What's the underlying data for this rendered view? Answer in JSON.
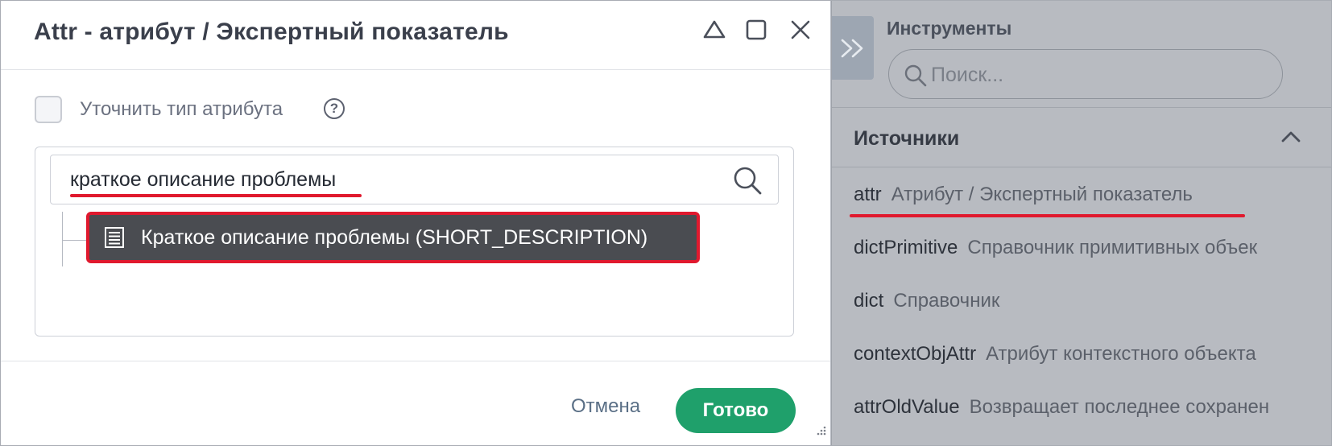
{
  "dialog": {
    "title": "Attr - атрибут / Экспертный показатель",
    "checkbox_label": "Уточнить тип атрибута",
    "help_symbol": "?",
    "search_value": "краткое описание проблемы",
    "tree_item_label": "Краткое описание проблемы (SHORT_DESCRIPTION)",
    "cancel_label": "Отмена",
    "ok_label": "Готово"
  },
  "tools": {
    "title": "Инструменты",
    "search_placeholder": "Поиск...",
    "sources_title": "Источники",
    "items": [
      {
        "key": "attr",
        "desc": "Атрибут / Экспертный показатель"
      },
      {
        "key": "dictPrimitive",
        "desc": "Справочник примитивных объек"
      },
      {
        "key": "dict",
        "desc": "Справочник"
      },
      {
        "key": "contextObjAttr",
        "desc": "Атрибут контекстного объекта"
      },
      {
        "key": "attrOldValue",
        "desc": "Возвращает последнее сохранен"
      }
    ]
  },
  "colors": {
    "accent_green": "#1fa06b",
    "highlight_red": "#e0192e",
    "selected_item_bg": "#4a4c51",
    "tools_bg": "#b8bbc1"
  },
  "icons": [
    "minimize-icon",
    "maximize-icon",
    "close-icon",
    "help-icon",
    "search-icon",
    "document-list-icon",
    "expand-panel-icon",
    "chevron-up-icon",
    "resize-grip-icon"
  ]
}
